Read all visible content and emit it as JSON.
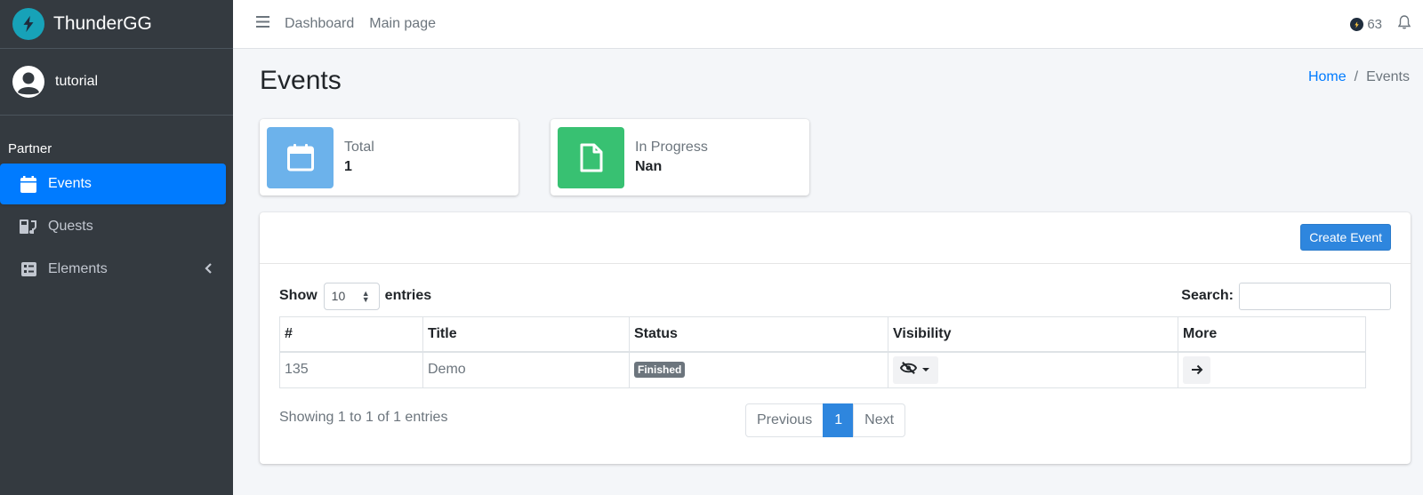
{
  "brand": {
    "name": "ThunderGG"
  },
  "user": {
    "name": "tutorial"
  },
  "sidebar": {
    "header": "Partner",
    "items": [
      {
        "label": "Events",
        "icon": "calendar-icon",
        "active": true
      },
      {
        "label": "Quests",
        "icon": "quests-icon"
      },
      {
        "label": "Elements",
        "icon": "list-icon",
        "has_submenu": true
      }
    ]
  },
  "topbar": {
    "links": [
      "Dashboard",
      "Main page"
    ],
    "credits": "63"
  },
  "page": {
    "title": "Events",
    "breadcrumb": {
      "home": "Home",
      "separator": "/",
      "current": "Events"
    }
  },
  "stats": [
    {
      "label": "Total",
      "value": "1",
      "color": "#6cb2eb",
      "icon": "calendar-icon"
    },
    {
      "label": "In Progress",
      "value": "Nan",
      "color": "#38c172",
      "icon": "file-icon"
    }
  ],
  "card": {
    "create_button": "Create Event"
  },
  "datatable": {
    "show_label": "Show",
    "length_value": "10",
    "entries_label": "entries",
    "search_label": "Search:",
    "search_value": "",
    "columns": [
      "#",
      "Title",
      "Status",
      "Visibility",
      "More"
    ],
    "rows": [
      {
        "id": "135",
        "title": "Demo",
        "status": "Finished"
      }
    ],
    "info": "Showing 1 to 1 of 1 entries",
    "pagination": {
      "previous": "Previous",
      "current": "1",
      "next": "Next"
    }
  },
  "colors": {
    "sidebar": "#343a40",
    "active": "#007bff",
    "primary_button": "#2e86de"
  }
}
